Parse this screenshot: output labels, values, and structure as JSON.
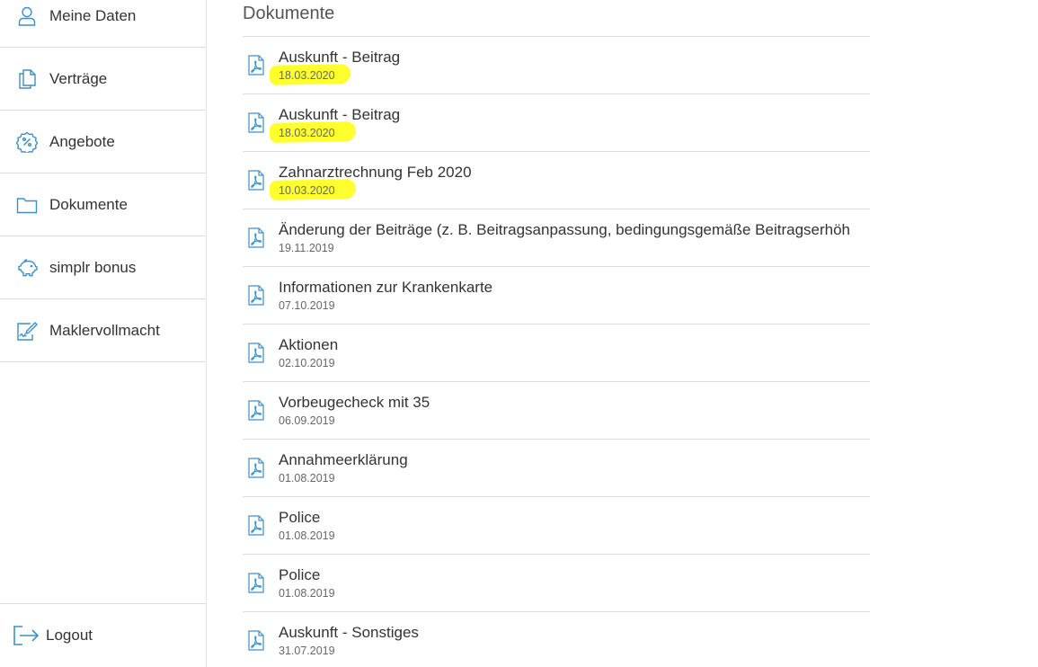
{
  "sidebar": {
    "items": [
      {
        "label": "Meine Daten",
        "icon": "user-icon"
      },
      {
        "label": "Verträge",
        "icon": "documents-icon"
      },
      {
        "label": "Angebote",
        "icon": "percent-badge-icon"
      },
      {
        "label": "Dokumente",
        "icon": "folder-icon"
      },
      {
        "label": "simplr bonus",
        "icon": "piggy-bank-icon"
      },
      {
        "label": "Maklervollmacht",
        "icon": "signature-icon"
      }
    ],
    "logout_label": "Logout"
  },
  "main": {
    "title": "Dokumente",
    "documents": [
      {
        "title": "Auskunft - Beitrag",
        "date": "18.03.2020",
        "highlighted": true
      },
      {
        "title": "Auskunft - Beitrag",
        "date": "18.03.2020",
        "highlighted": true
      },
      {
        "title": "Zahnarztrechnung Feb 2020",
        "date": "10.03.2020",
        "highlighted": true
      },
      {
        "title": "Änderung der Beiträge (z. B. Beitragsanpassung, bedingungsgemäße Beitragserhöh",
        "date": "19.11.2019",
        "highlighted": false
      },
      {
        "title": "Informationen zur Krankenkarte",
        "date": "07.10.2019",
        "highlighted": false
      },
      {
        "title": "Aktionen",
        "date": "02.10.2019",
        "highlighted": false
      },
      {
        "title": "Vorbeugecheck mit 35",
        "date": "06.09.2019",
        "highlighted": false
      },
      {
        "title": "Annahmeerklärung",
        "date": "01.08.2019",
        "highlighted": false
      },
      {
        "title": "Police",
        "date": "01.08.2019",
        "highlighted": false
      },
      {
        "title": "Police",
        "date": "01.08.2019",
        "highlighted": false
      },
      {
        "title": "Auskunft - Sonstiges",
        "date": "31.07.2019",
        "highlighted": false
      }
    ]
  },
  "colors": {
    "icon_blue": "#3d8fc7",
    "highlight_yellow": "#ffff2e",
    "divider": "#dcdcdc"
  }
}
